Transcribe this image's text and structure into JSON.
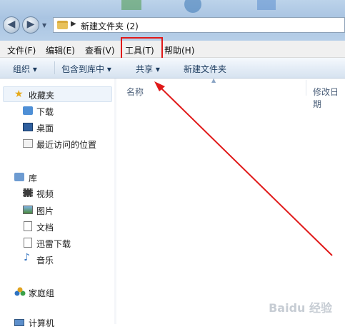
{
  "address": {
    "path": "新建文件夹 (2)"
  },
  "menu": [
    "文件(F)",
    "编辑(E)",
    "查看(V)",
    "工具(T)",
    "帮助(H)"
  ],
  "toolbar": {
    "organize": "组织 ▾",
    "include": "包含到库中 ▾",
    "share": "共享 ▾",
    "new_folder": "新建文件夹"
  },
  "nav": {
    "favorites": "收藏夹",
    "downloads": "下载",
    "desktop": "桌面",
    "recent": "最近访问的位置",
    "libraries": "库",
    "videos": "视频",
    "pictures": "图片",
    "documents": "文档",
    "thunder": "迅雷下载",
    "music": "音乐",
    "homegroup": "家庭组",
    "computer": "计算机"
  },
  "columns": {
    "name": "名称",
    "modified": "修改日期"
  },
  "colors": {
    "annotation": "#e01919",
    "accent": "#3a78c2"
  }
}
